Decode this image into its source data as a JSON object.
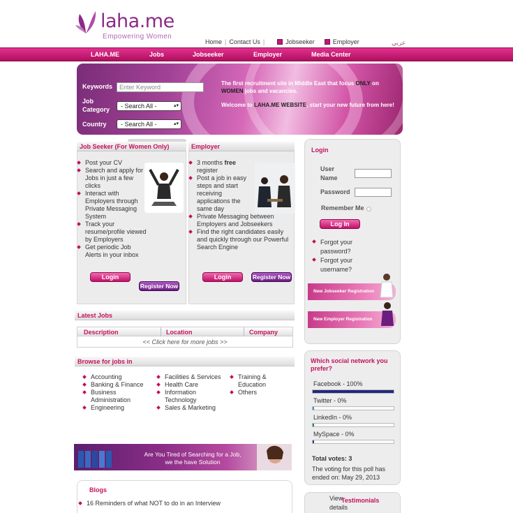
{
  "brand": {
    "name": "laha.me",
    "tagline": "Empowering Women"
  },
  "top_links": {
    "home": "Home",
    "contact": "Contact Us",
    "jobseeker": "Jobseeker",
    "employer": "Employer",
    "arabic": "عربي"
  },
  "nav": [
    "LAHA.ME",
    "Jobs",
    "Jobseeker",
    "Employer",
    "Media Center"
  ],
  "search": {
    "keywords_label": "Keywords",
    "keywords_placeholder": "Enter Keyword",
    "category_label": "Job Category",
    "category_value": "- Search All -",
    "country_label": "Country",
    "country_value": "- Search All -"
  },
  "hero_text": {
    "line1_a": "The first recruitment site in Middle East that focus ",
    "line1_b": "ONLY",
    "line1_c": " on ",
    "line1_d": "WOMEN",
    "line1_e": " jobs and vacancies.",
    "line2_a": "Welcome to ",
    "line2_b": "LAHA.ME WEBSITE",
    "line2_c": ", start your new future from here!"
  },
  "jobseeker": {
    "title": "Job Seeker (For Women Only)",
    "items": [
      "Post your CV",
      "Search and apply for Jobs in just a few clicks",
      "Interact with Employers through Private Messaging System",
      "Track your resume/profile viewed by Employers",
      "Get periodic Job Alerts in your inbox"
    ],
    "login": "Login",
    "register": "Register Now"
  },
  "employer": {
    "title": "Employer",
    "item1_a": "3 months ",
    "item1_b": "free",
    "item1_c": " register",
    "items": [
      "Post a job in easy steps and start receiving applications the same day",
      "Private Messaging between Employers and Jobseekers",
      "Find the right candidates easily and quickly through our Powerful Search Engine"
    ],
    "login": "Login",
    "register": "Register Now"
  },
  "latest_jobs": {
    "title": "Latest Jobs",
    "headers": [
      "Description",
      "Location",
      "Company"
    ],
    "more": "<< Click here for more jobs >>"
  },
  "browse": {
    "title": "Browse for jobs in",
    "col1": [
      "Accounting",
      "Banking & Finance",
      "Business Administration",
      "Engineering"
    ],
    "col2": [
      "Facilities & Services",
      "Health Care",
      "Information Technology",
      "Sales & Marketing"
    ],
    "col3": [
      "Training & Education",
      "Others"
    ]
  },
  "promo": {
    "line1": "Are You Tired of Searching for a Job,",
    "line2": "we the have Solution"
  },
  "blogs": {
    "title": "Blogs",
    "items": [
      "16 Reminders of what NOT to do in an Interview"
    ]
  },
  "login_panel": {
    "title": "Login",
    "user_label": "User Name",
    "password_label": "Password",
    "remember_label": "Remember Me",
    "button": "Log In",
    "forgot_password": "Forgot your password?",
    "forgot_username": "Forgot your username?",
    "new_jobseeker": "New Jobseeker Registration",
    "new_employer": "New Employer Registration"
  },
  "poll": {
    "question": "Which social network you prefer?",
    "options": [
      {
        "label": "Facebook - 100%",
        "pct": 100,
        "color": "#1f2a7a"
      },
      {
        "label": "Twitter - 0%",
        "pct": 0,
        "color": "#3a8fd0"
      },
      {
        "label": "LinkedIn - 0%",
        "pct": 0,
        "color": "#2a8a3a"
      },
      {
        "label": "MySpace - 0%",
        "pct": 0,
        "color": "#5a2a8a"
      }
    ],
    "total": "Total votes: 3",
    "ended": "The voting for this poll has ended on: May 29, 2013"
  },
  "testimonials": {
    "view": "View",
    "title": "Testimonials",
    "details": "details"
  }
}
